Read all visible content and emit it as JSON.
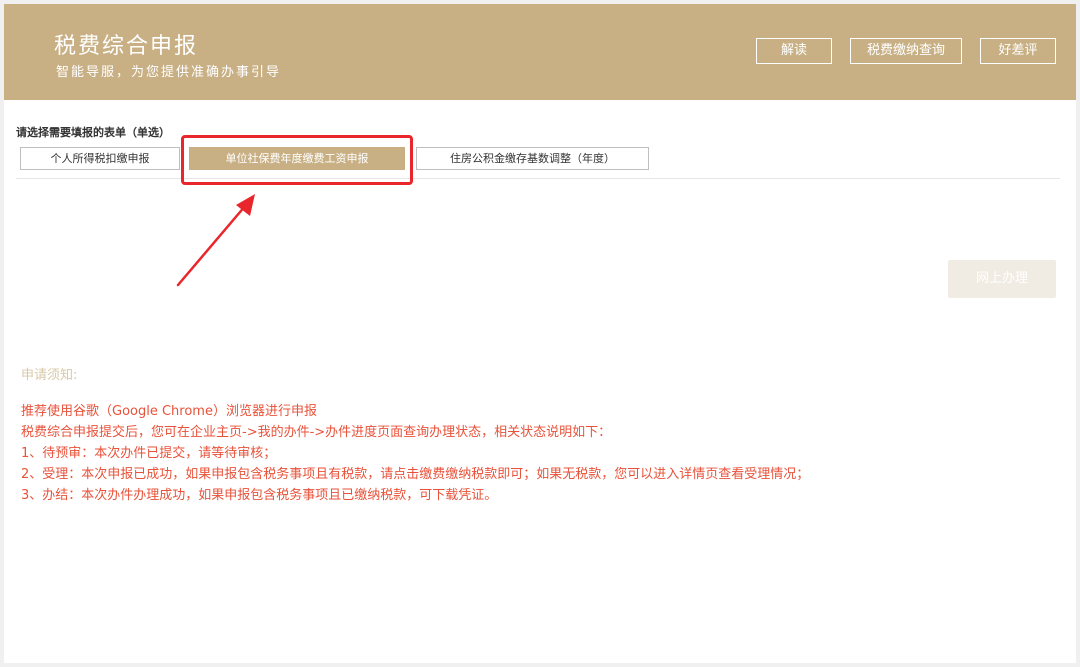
{
  "header": {
    "title": "税费综合申报",
    "subtitle": "智能导服，为您提供准确办事引导",
    "buttons": [
      "解读",
      "税费缴纳查询",
      "好差评"
    ]
  },
  "form": {
    "label": "请选择需要填报的表单（单选）",
    "options": [
      "个人所得税扣缴申报",
      "单位社保费年度缴费工资申报",
      "住房公积金缴存基数调整（年度）"
    ],
    "selected_index": 1
  },
  "online_button": "网上办理",
  "notice": {
    "title": "申请须知:",
    "lines": [
      "推荐使用谷歌（Google Chrome）浏览器进行申报",
      "税费综合申报提交后，您可在企业主页->我的办件->办件进度页面查询办理状态，相关状态说明如下：",
      "1、待预审：本次办件已提交，请等待审核；",
      "2、受理：本次申报已成功，如果申报包含税务事项且有税款，请点击缴费缴纳税款即可；如果无税款，您可以进入详情页查看受理情况；",
      "3、办结：本次办件办理成功，如果申报包含税务事项且已缴纳税款，可下载凭证。"
    ]
  },
  "colors": {
    "brand": "#c8b084",
    "annotation": "#e8262b",
    "notice_text": "#e8523a"
  }
}
